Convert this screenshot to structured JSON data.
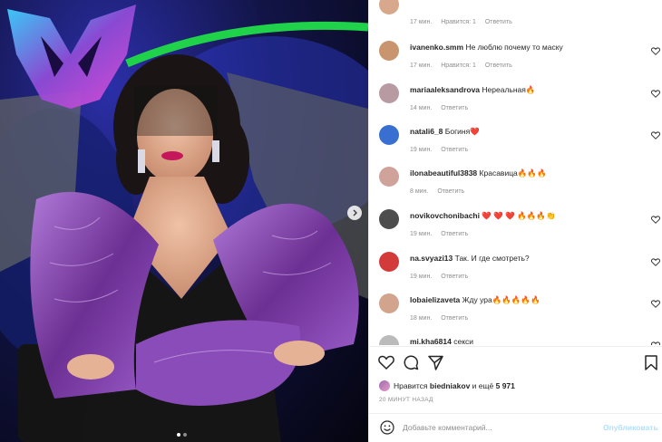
{
  "post": {
    "previous_comment": {
      "time": "17 мин.",
      "likes": "Нравится: 1",
      "reply": "Ответить"
    },
    "comments": [
      {
        "username": "ivanenko.smm",
        "text": "Не люблю почему то маску",
        "time": "17 мин.",
        "likes": "Нравится: 1",
        "reply": "Ответить",
        "avatar_color": "#c9956f"
      },
      {
        "username": "mariaaleksandrova",
        "text": "Нереальная🔥",
        "time": "14 мин.",
        "likes": "",
        "reply": "Ответить",
        "avatar_color": "#b79aa2"
      },
      {
        "username": "natali6_8",
        "text": "Богиня❤️",
        "time": "19 мин.",
        "likes": "",
        "reply": "Ответить",
        "avatar_color": "#3a6fd2"
      },
      {
        "username": "ilonabeautiful3838",
        "text": "Красавица🔥🔥🔥",
        "time": "8 мин.",
        "likes": "",
        "reply": "Ответить",
        "avatar_color": "#cfa39a"
      },
      {
        "username": "novikovchonibachi",
        "text": "❤️ ❤️ ❤️ 🔥🔥🔥👏",
        "time": "19 мин.",
        "likes": "",
        "reply": "Ответить",
        "avatar_color": "#4d4d4d"
      },
      {
        "username": "na.svyazi13",
        "text": "Так. И где смотреть?",
        "time": "19 мин.",
        "likes": "",
        "reply": "Ответить",
        "avatar_color": "#d33b3b"
      },
      {
        "username": "lobaielizaveta",
        "text": "Жду ура🔥🔥🔥🔥🔥",
        "time": "18 мин.",
        "likes": "",
        "reply": "Ответить",
        "avatar_color": "#d2a48d"
      },
      {
        "username": "mi.kha6814",
        "text": "секси",
        "time": "",
        "likes": "",
        "reply": "",
        "avatar_color": "#bbbbbb"
      }
    ],
    "liked_by_prefix": "Нравится",
    "liked_by_user": "biedniakov",
    "liked_by_joiner": "и ещё",
    "liked_by_count": "5 971",
    "time_ago": "20 МИНУТ НАЗАД",
    "comment_placeholder": "Добавьте комментарий...",
    "publish_label": "Опубликовать"
  },
  "icons": {
    "like": "heart-icon",
    "comment": "comment-icon",
    "share": "share-icon",
    "save": "bookmark-icon",
    "emoji": "smiley-icon",
    "next": "chevron-right-icon"
  },
  "colors": {
    "meta_gray": "#8e8e8e",
    "publish_disabled": "#b2dffc",
    "dress_purple": "#7a3f9e",
    "mask_neon": "#8f4bd6"
  }
}
